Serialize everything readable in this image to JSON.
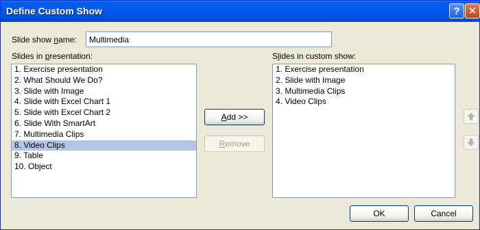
{
  "window": {
    "title": "Define Custom Show",
    "help_glyph": "?",
    "close_glyph": "✕"
  },
  "name_field": {
    "label_pre": "Slide show ",
    "label_ul": "n",
    "label_post": "ame:",
    "value": "Multimedia"
  },
  "left_panel": {
    "label_pre": "Slides in ",
    "label_ul": "p",
    "label_post": "resentation:",
    "items": [
      "1. Exercise presentation",
      "2. What Should We Do?",
      "3. Slide with Image",
      "4. Slide with Excel Chart 1",
      "5. Slide with Excel Chart 2",
      "6. Slide With SmartArt",
      "7. Multimedia Clips",
      "8. Video Clips",
      "9. Table",
      "10. Object"
    ],
    "selected_index": 7
  },
  "right_panel": {
    "label_pre": "S",
    "label_ul": "l",
    "label_post": "ides in custom show:",
    "items": [
      "1. Exercise presentation",
      "2. Slide with Image",
      "3. Multimedia Clips",
      "4. Video Clips"
    ]
  },
  "buttons": {
    "add_ul": "A",
    "add_post": "dd >>",
    "remove_ul": "R",
    "remove_post": "emove",
    "ok": "OK",
    "cancel": "Cancel"
  },
  "icons": {
    "move_up": "arrow-up-icon",
    "move_down": "arrow-down-icon"
  },
  "colors": {
    "titlebar": "#0058EE",
    "dialog_bg": "#ECE9D8",
    "selection": "#B4C5E8"
  }
}
